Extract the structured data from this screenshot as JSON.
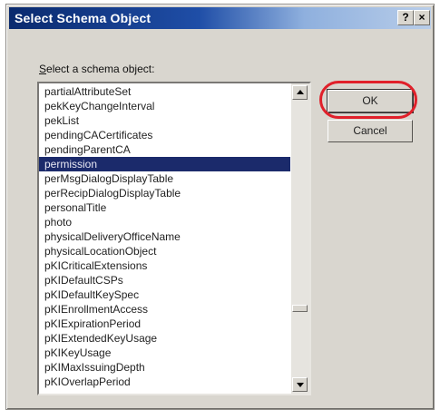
{
  "window": {
    "title": "Select Schema Object",
    "help_label": "?",
    "close_label": "×"
  },
  "label": {
    "prefix": "S",
    "rest": "elect a schema object:"
  },
  "list": {
    "items": [
      "partialAttributeSet",
      "pekKeyChangeInterval",
      "pekList",
      "pendingCACertificates",
      "pendingParentCA",
      "permission",
      "perMsgDialogDisplayTable",
      "perRecipDialogDisplayTable",
      "personalTitle",
      "photo",
      "physicalDeliveryOfficeName",
      "physicalLocationObject",
      "pKICriticalExtensions",
      "pKIDefaultCSPs",
      "pKIDefaultKeySpec",
      "pKIEnrollmentAccess",
      "pKIExpirationPeriod",
      "pKIExtendedKeyUsage",
      "pKIKeyUsage",
      "pKIMaxIssuingDepth",
      "pKIOverlapPeriod"
    ],
    "selected_index": 5
  },
  "buttons": {
    "ok_label": "OK",
    "cancel_label": "Cancel"
  },
  "colors": {
    "highlight": "#e0202a",
    "selection": "#1b2a6b",
    "title_bar": "#0a2a6e"
  }
}
